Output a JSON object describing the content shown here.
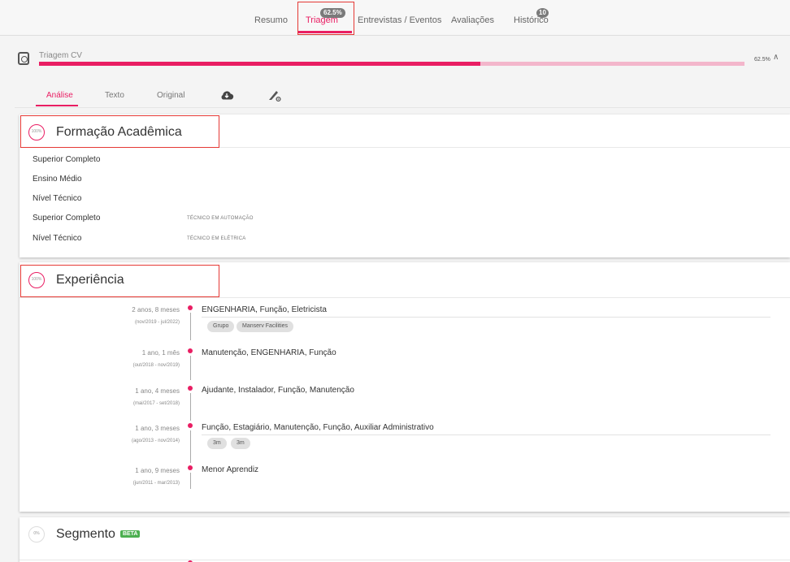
{
  "nav": {
    "tabs": [
      {
        "label": "Resumo"
      },
      {
        "label": "Triagem",
        "badge": "62.5%"
      },
      {
        "label": "Entrevistas / Eventos"
      },
      {
        "label": "Avaliações"
      },
      {
        "label": "Histórico",
        "badge": "10"
      }
    ],
    "active_tab": "Triagem"
  },
  "triagem": {
    "title": "Triagem CV",
    "percent_label": "62.5%",
    "progress": 0.625
  },
  "subtabs": [
    "Análise",
    "Texto",
    "Original"
  ],
  "sections": {
    "formacao": {
      "title": "Formação Acadêmica",
      "pct": "100%",
      "rows": [
        {
          "label": "Superior Completo",
          "detail": ""
        },
        {
          "label": "Ensino Médio",
          "detail": ""
        },
        {
          "label": "Nível Técnico",
          "detail": ""
        },
        {
          "label": "Superior Completo",
          "detail": "Técnico em automação"
        },
        {
          "label": "Nível Técnico",
          "detail": "Técnico em elétrica"
        }
      ]
    },
    "experiencia": {
      "title": "Experiência",
      "pct": "100%",
      "items": [
        {
          "duration": "2 anos, 8 meses",
          "range": "(nov/2019 - jul/2022)",
          "title": "ENGENHARIA, Função, Eletricista",
          "chips": [
            "Grupo",
            "Manserv Facilities"
          ]
        },
        {
          "duration": "1 ano, 1 mês",
          "range": "(out/2018 - nov/2019)",
          "title": "Manutenção, ENGENHARIA, Função",
          "chips": []
        },
        {
          "duration": "1 ano, 4 meses",
          "range": "(mai/2017 - set/2018)",
          "title": "Ajudante, Instalador, Função, Manutenção",
          "chips": []
        },
        {
          "duration": "1 ano, 3 meses",
          "range": "(ago/2013 - nov/2014)",
          "title": "Função, Estagiário, Manutenção, Função, Auxiliar Administrativo",
          "chips": [
            "3m",
            "3m"
          ]
        },
        {
          "duration": "1 ano, 9 meses",
          "range": "(jun/2011 - mar/2013)",
          "title": "Menor Aprendiz",
          "chips": []
        }
      ]
    },
    "segmento": {
      "title": "Segmento",
      "pct": "0%",
      "beta": "BETA"
    }
  },
  "colors": {
    "accent": "#e91e63",
    "progress_bg": "#f3b6cb",
    "highlight_box": "#e53935",
    "beta": "#4caf50"
  }
}
